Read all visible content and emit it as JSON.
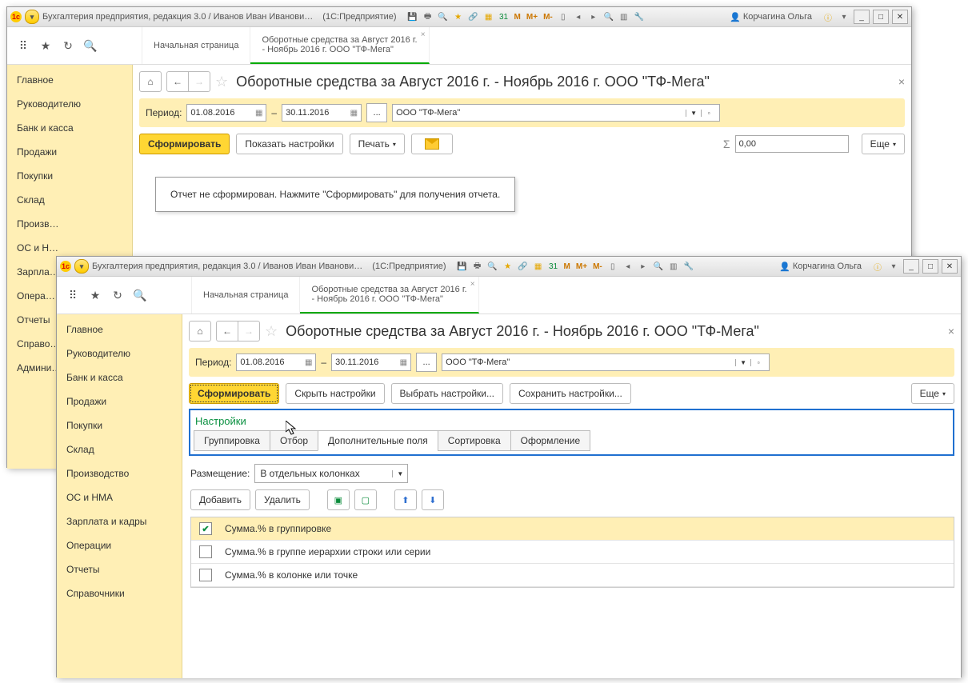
{
  "titlebar": {
    "app_title": "Бухгалтерия предприятия, редакция 3.0 / Иванов Иван Иванови…",
    "platform": "(1С:Предприятие)",
    "user": "Корчагина Ольга",
    "m_buttons": [
      "M",
      "M+",
      "M-"
    ]
  },
  "tabs": {
    "home": "Начальная страница",
    "report_line1": "Оборотные средства за Август 2016 г.",
    "report_line2": "- Ноябрь 2016 г. ООО \"ТФ-Мега\""
  },
  "sidebar": {
    "items": [
      "Главное",
      "Руководителю",
      "Банк и касса",
      "Продажи",
      "Покупки",
      "Склад",
      "Производство",
      "ОС и НМА",
      "Зарплата и кадры",
      "Операции",
      "Отчеты",
      "Справочники",
      "Администрирование"
    ],
    "items_trunc": [
      "Главное",
      "Руководителю",
      "Банк и касса",
      "Продажи",
      "Покупки",
      "Склад",
      "Произв…",
      "ОС и Н…",
      "Зарпла…",
      "Опера…",
      "Отчеты",
      "Справо…",
      "Админи…"
    ]
  },
  "page": {
    "title": "Оборотные средства за Август 2016 г. - Ноябрь 2016 г. ООО \"ТФ-Мега\"",
    "period_label": "Период:",
    "date_from": "01.08.2016",
    "date_to": "30.11.2016",
    "dash": "–",
    "ellipsis": "...",
    "org": "ООО \"ТФ-Мега\"",
    "form_btn": "Сформировать",
    "show_settings": "Показать настройки",
    "hide_settings": "Скрыть настройки",
    "choose_settings": "Выбрать настройки...",
    "save_settings": "Сохранить настройки...",
    "print": "Печать",
    "sum_value": "0,00",
    "more": "Еще",
    "placeholder_msg": "Отчет не сформирован. Нажмите \"Сформировать\" для получения отчета."
  },
  "settings": {
    "title": "Настройки",
    "tabs": [
      "Группировка",
      "Отбор",
      "Дополнительные поля",
      "Сортировка",
      "Оформление"
    ],
    "active_tab": 2,
    "placement_label": "Размещение:",
    "placement_value": "В отдельных колонках",
    "add": "Добавить",
    "delete": "Удалить",
    "fields": [
      {
        "checked": true,
        "label": "Сумма.% в группировке"
      },
      {
        "checked": false,
        "label": "Сумма.% в группе иерархии строки или серии"
      },
      {
        "checked": false,
        "label": "Сумма.% в колонке или точке"
      }
    ]
  }
}
